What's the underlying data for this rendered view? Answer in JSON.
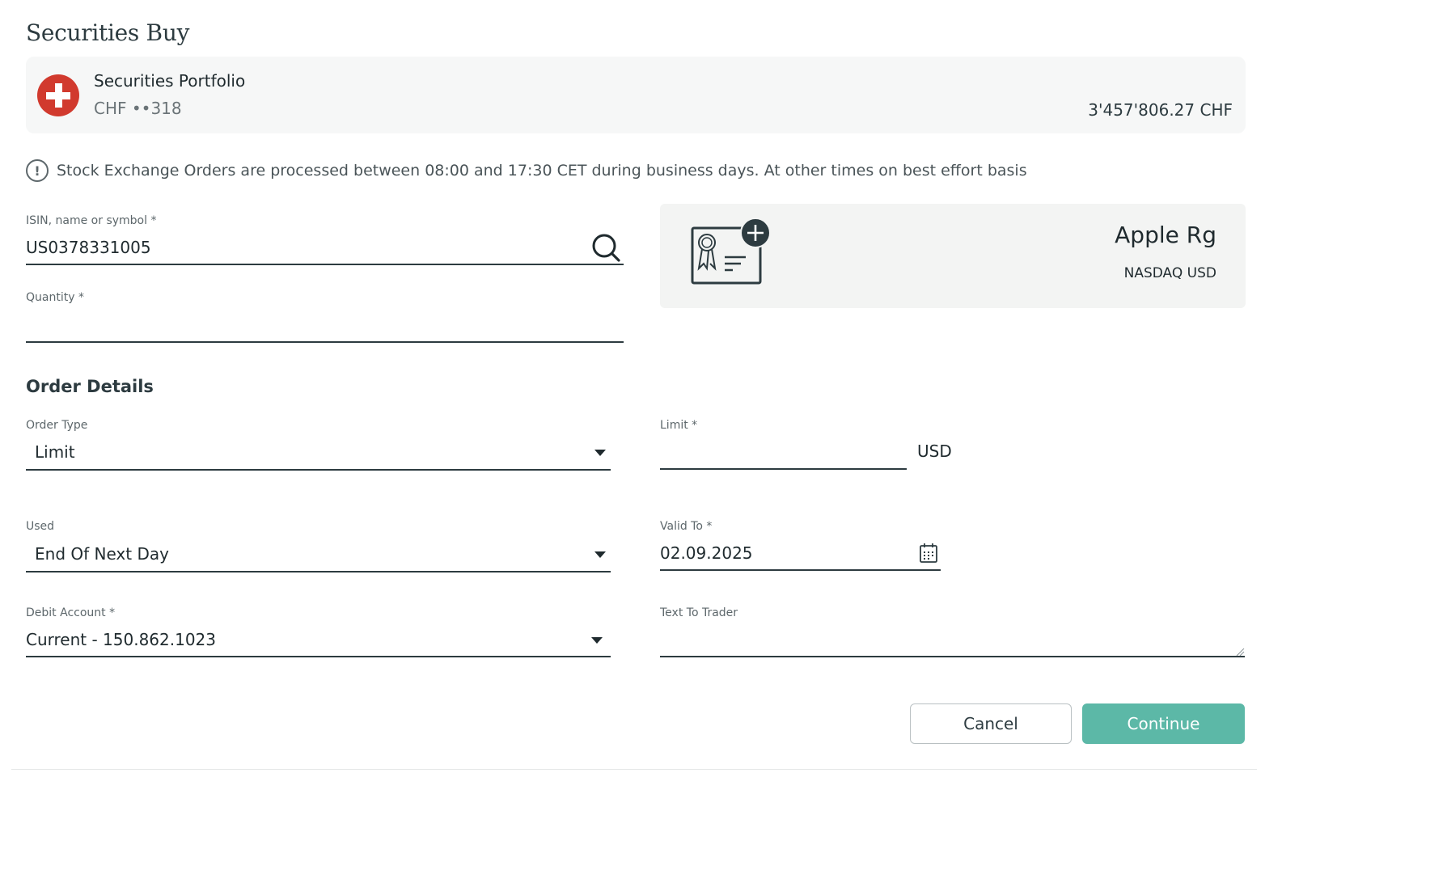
{
  "page": {
    "title": "Securities Buy"
  },
  "portfolio": {
    "name": "Securities Portfolio",
    "account": "CHF ••318",
    "balance": "3'457'806.27 CHF",
    "flag_icon": "swiss-flag-icon"
  },
  "notice": {
    "icon": "exclamation-circle-icon",
    "text": "Stock Exchange Orders are processed between 08:00 and 17:30 CET during business days. At other times on best effort basis"
  },
  "search": {
    "label": "ISIN, name or symbol",
    "required_mark": "*",
    "value": "US0378331005",
    "icon": "search-icon"
  },
  "quantity": {
    "label": "Quantity",
    "required_mark": "*",
    "value": ""
  },
  "instrument": {
    "name": "Apple Rg",
    "exchange": "NASDAQ USD",
    "icon": "certificate-add-icon"
  },
  "order_details": {
    "title": "Order Details",
    "order_type": {
      "label": "Order Type",
      "value": "Limit"
    },
    "limit": {
      "label": "Limit",
      "required_mark": "*",
      "value": "",
      "currency": "USD"
    },
    "used": {
      "label": "Used",
      "value": "End Of Next Day"
    },
    "valid_to": {
      "label": "Valid To",
      "required_mark": "*",
      "value": "02.09.2025",
      "icon": "calendar-icon"
    },
    "debit_account": {
      "label": "Debit Account",
      "required_mark": "*",
      "value": "Current - 150.862.1023"
    },
    "text_to_trader": {
      "label": "Text To Trader",
      "value": ""
    }
  },
  "actions": {
    "cancel_label": "Cancel",
    "continue_label": "Continue"
  },
  "colors": {
    "accent": "#5cb8a7",
    "flag_red": "#d13a2e",
    "panel_bg": "#f6f7f7",
    "text_dark": "#1f2a2e"
  }
}
